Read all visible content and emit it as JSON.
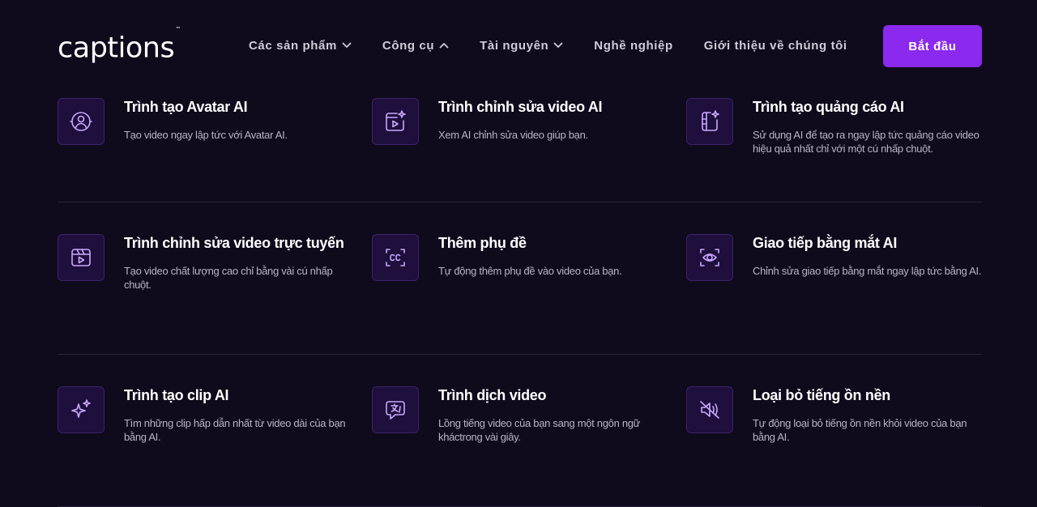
{
  "header": {
    "logo": "captions",
    "logo_tm": "™",
    "nav": [
      {
        "label": "Các sản phẩm",
        "chevron": "down"
      },
      {
        "label": "Công cụ",
        "chevron": "up"
      },
      {
        "label": "Tài nguyên",
        "chevron": "down"
      },
      {
        "label": "Nghề nghiệp"
      },
      {
        "label": "Giới thiệu về chúng tôi"
      }
    ],
    "cta_label": "Bắt đầu"
  },
  "colors": {
    "background": "#0f0a1c",
    "accent": "#8b29ee",
    "icon_bg": "#1e0f3c",
    "icon_stroke": "#c9a8ff"
  },
  "tools": [
    [
      {
        "icon": "avatar-face-icon",
        "title": "Trình tạo Avatar AI",
        "desc": "Tạo video ngay lập tức với Avatar AI."
      },
      {
        "icon": "video-edit-sparkle-icon",
        "title": "Trình chỉnh sửa video AI",
        "desc": "Xem AI chỉnh sửa video giúp bạn."
      },
      {
        "icon": "ad-sparkle-icon",
        "title": "Trình tạo quảng cáo AI",
        "desc": "Sử dụng AI để tạo ra ngay lập tức quảng cáo video hiệu quả nhất chỉ với một cú nhấp chuột."
      }
    ],
    [
      {
        "icon": "video-player-icon",
        "title": "Trình chỉnh sửa video trực tuyến",
        "desc": "Tạo video chất lượng cao chỉ bằng vài cú nhấp chuột."
      },
      {
        "icon": "captions-cc-icon",
        "title": "Thêm phụ đề",
        "desc": "Tự động thêm phụ đề vào video của bạn."
      },
      {
        "icon": "eye-contact-icon",
        "title": "Giao tiếp bằng mắt AI",
        "desc": "Chỉnh sửa giao tiếp bằng mắt ngay lập tức bằng AI."
      }
    ],
    [
      {
        "icon": "sparkles-icon",
        "title": "Trình tạo clip AI",
        "desc": "Tìm những clip hấp dẫn nhất từ video dài của bạn bằng AI."
      },
      {
        "icon": "translate-chat-icon",
        "title": "Trình dịch video",
        "desc": "Lồng tiếng video của bạn sang một ngôn ngữ kháctrong vài giây."
      },
      {
        "icon": "noise-mute-icon",
        "title": "Loại bỏ tiếng ồn nền",
        "desc": "Tự động loại bỏ tiếng ồn nền khỏi video của bạn bằng AI."
      }
    ]
  ]
}
